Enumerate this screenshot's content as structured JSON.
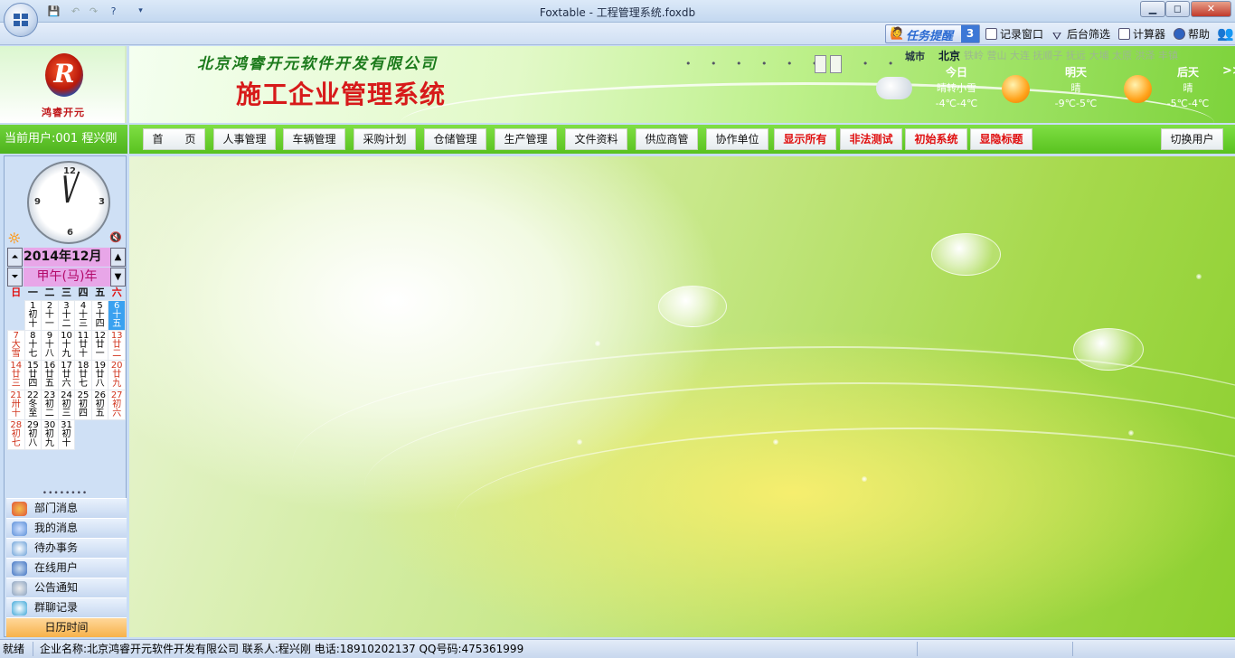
{
  "window": {
    "title": "Foxtable - 工程管理系统.foxdb",
    "min_label": "▁",
    "max_label": "◻",
    "close_label": "✕"
  },
  "toolbar": {
    "task_reminder_label": "任务提醒",
    "task_count": "3",
    "record_window": "记录窗口",
    "backend_filter": "后台筛选",
    "calculator": "计算器",
    "help": "帮助"
  },
  "logo": {
    "mark": "R",
    "text": "鸿睿开元"
  },
  "header": {
    "company_name": "北京鸿睿开元软件开发有限公司",
    "system_name": "施工企业管理系统",
    "dots": "• • • • • • • • •"
  },
  "weather": {
    "city_label": "城市",
    "current_city": "北京",
    "other_cities": "铁岭 营山 大连 抚顺子 抚远 大埔 太原 洪泽 丰镇",
    "arrow": ">>",
    "days": [
      {
        "name": "今日",
        "desc": "晴转小雪",
        "temp": "-4℃-4℃"
      },
      {
        "name": "明天",
        "desc": "晴",
        "temp": "-9℃-5℃"
      },
      {
        "name": "后天",
        "desc": "晴",
        "temp": "-5℃-4℃"
      }
    ]
  },
  "user": {
    "current_user_text": "当前用户:001 程兴刚"
  },
  "nav": {
    "items": [
      {
        "label": "首　　页",
        "red": false
      },
      {
        "label": "人事管理",
        "red": false
      },
      {
        "label": "车辆管理",
        "red": false
      },
      {
        "label": "采购计划",
        "red": false
      },
      {
        "label": "仓储管理",
        "red": false
      },
      {
        "label": "生产管理",
        "red": false
      },
      {
        "label": "文件资料",
        "red": false
      },
      {
        "label": "供应商管",
        "red": false
      },
      {
        "label": "协作单位",
        "red": false
      },
      {
        "label": "显示所有",
        "red": true
      },
      {
        "label": "非法测试",
        "red": true
      },
      {
        "label": "初始系统",
        "red": true
      },
      {
        "label": "显隐标题",
        "red": true
      }
    ],
    "switch_user": "切换用户"
  },
  "calendar": {
    "year_month": "2014年12月",
    "ganzhi_year": "甲午(马)年",
    "weekdays": [
      "日",
      "一",
      "二",
      "三",
      "四",
      "五",
      "六"
    ],
    "weeks": [
      [
        null,
        {
          "d": "1",
          "l": "初十"
        },
        {
          "d": "2",
          "l": "十一"
        },
        {
          "d": "3",
          "l": "十二"
        },
        {
          "d": "4",
          "l": "十三"
        },
        {
          "d": "5",
          "l": "十四"
        },
        {
          "d": "6",
          "l": "十五",
          "today": true
        }
      ],
      [
        {
          "d": "7",
          "l": "大雪"
        },
        {
          "d": "8",
          "l": "十七"
        },
        {
          "d": "9",
          "l": "十八"
        },
        {
          "d": "10",
          "l": "十九"
        },
        {
          "d": "11",
          "l": "廿十"
        },
        {
          "d": "12",
          "l": "廿一"
        },
        {
          "d": "13",
          "l": "廿二"
        }
      ],
      [
        {
          "d": "14",
          "l": "廿三"
        },
        {
          "d": "15",
          "l": "廿四"
        },
        {
          "d": "16",
          "l": "廿五"
        },
        {
          "d": "17",
          "l": "廿六"
        },
        {
          "d": "18",
          "l": "廿七"
        },
        {
          "d": "19",
          "l": "廿八"
        },
        {
          "d": "20",
          "l": "廿九"
        }
      ],
      [
        {
          "d": "21",
          "l": "卅十"
        },
        {
          "d": "22",
          "l": "冬至"
        },
        {
          "d": "23",
          "l": "初二"
        },
        {
          "d": "24",
          "l": "初三"
        },
        {
          "d": "25",
          "l": "初四"
        },
        {
          "d": "26",
          "l": "初五"
        },
        {
          "d": "27",
          "l": "初六"
        }
      ],
      [
        {
          "d": "28",
          "l": "初七"
        },
        {
          "d": "29",
          "l": "初八"
        },
        {
          "d": "30",
          "l": "初九"
        },
        {
          "d": "31",
          "l": "初十"
        },
        null,
        null,
        null
      ]
    ],
    "dots": "••••••••"
  },
  "side_menu": {
    "items": [
      {
        "label": "部门消息",
        "icon": "department-message-icon",
        "color": "#e0533a"
      },
      {
        "label": "我的消息",
        "icon": "my-message-icon",
        "color": "#5b8fd8"
      },
      {
        "label": "待办事务",
        "icon": "todo-icon",
        "color": "#6aa0d8"
      },
      {
        "label": "在线用户",
        "icon": "online-users-icon",
        "color": "#3f72c4"
      },
      {
        "label": "公告通知",
        "icon": "announcement-icon",
        "color": "#8aa2c0"
      },
      {
        "label": "群聊记录",
        "icon": "group-chat-icon",
        "color": "#3aa6d8"
      },
      {
        "label": "日历时间",
        "icon": "",
        "color": "#f7b24a",
        "active": true
      }
    ]
  },
  "status": {
    "ready": "就绪",
    "info": "企业名称:北京鸿睿开元软件开发有限公司  联系人:程兴刚 电话:18910202137 QQ号码:475361999"
  },
  "colors": {
    "accent_green": "#59c21f",
    "nav_red_text": "#e01010",
    "title_red": "#d71a1a",
    "company_green": "#1b7a1b"
  }
}
